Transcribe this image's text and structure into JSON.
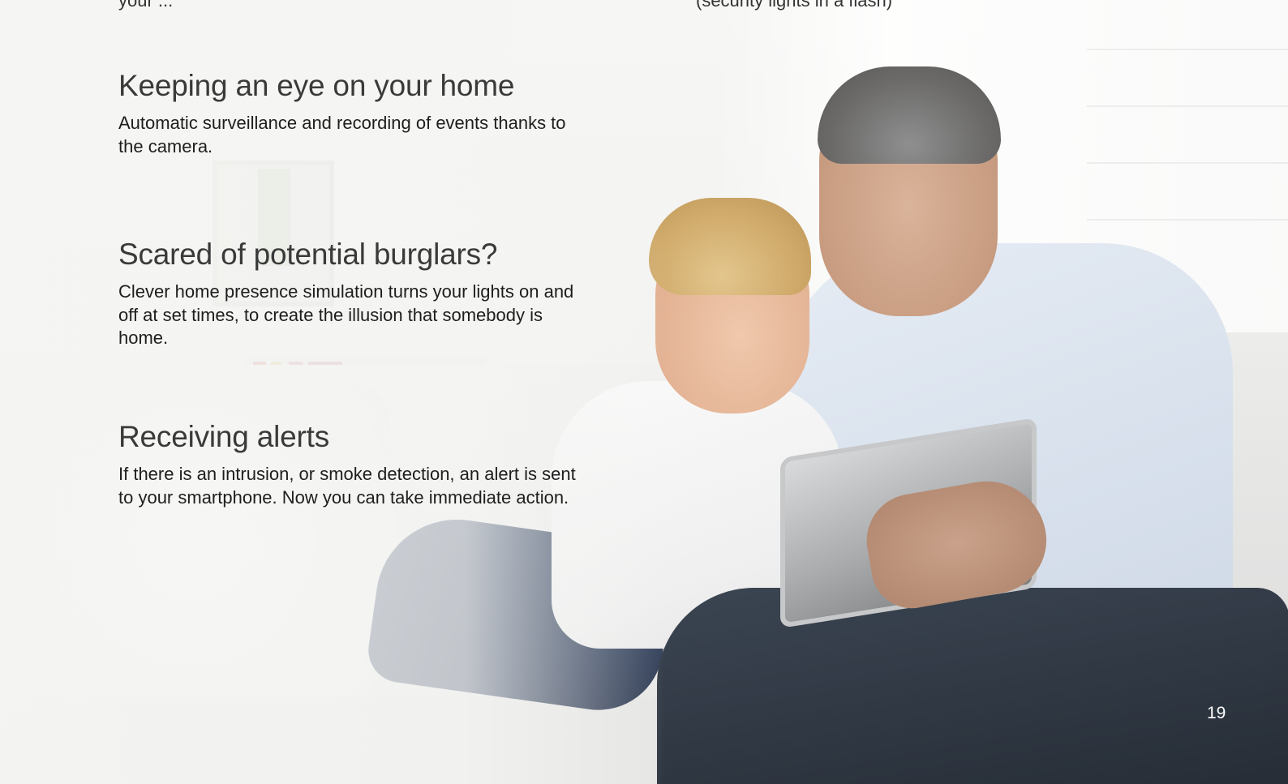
{
  "top_cut_text": {
    "left": "your ...",
    "right": "(security lights in a flash)"
  },
  "sections": [
    {
      "heading": "Keeping an eye on your home",
      "body": "Automatic surveillance and recording of events thanks to the camera."
    },
    {
      "heading": "Scared of potential burglars?",
      "body": "Clever home presence simulation turns your lights on and off at set times, to create the illusion that somebody is home."
    },
    {
      "heading": "Receiving alerts",
      "body": "If there is an intrusion, or smoke detection, an alert is sent to your smartphone. Now you can take immediate action."
    }
  ],
  "page_number": "19"
}
